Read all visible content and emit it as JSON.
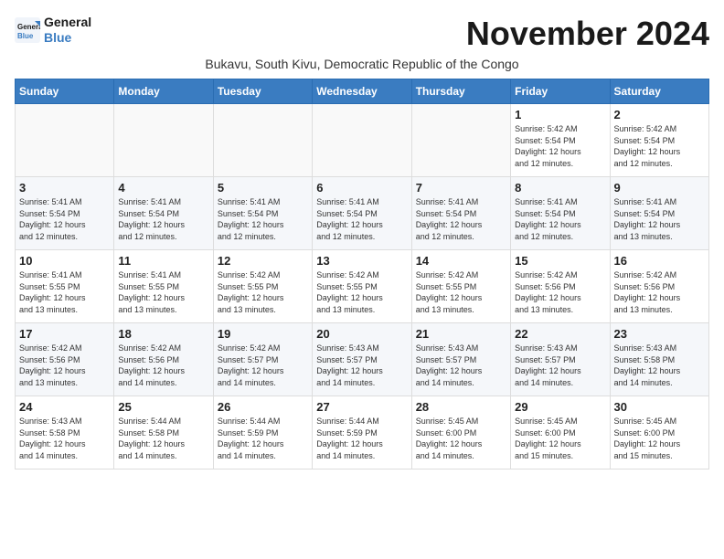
{
  "header": {
    "logo_line1": "General",
    "logo_line2": "Blue",
    "month_title": "November 2024",
    "subtitle": "Bukavu, South Kivu, Democratic Republic of the Congo"
  },
  "weekdays": [
    "Sunday",
    "Monday",
    "Tuesday",
    "Wednesday",
    "Thursday",
    "Friday",
    "Saturday"
  ],
  "weeks": [
    [
      {
        "day": "",
        "info": ""
      },
      {
        "day": "",
        "info": ""
      },
      {
        "day": "",
        "info": ""
      },
      {
        "day": "",
        "info": ""
      },
      {
        "day": "",
        "info": ""
      },
      {
        "day": "1",
        "info": "Sunrise: 5:42 AM\nSunset: 5:54 PM\nDaylight: 12 hours\nand 12 minutes."
      },
      {
        "day": "2",
        "info": "Sunrise: 5:42 AM\nSunset: 5:54 PM\nDaylight: 12 hours\nand 12 minutes."
      }
    ],
    [
      {
        "day": "3",
        "info": "Sunrise: 5:41 AM\nSunset: 5:54 PM\nDaylight: 12 hours\nand 12 minutes."
      },
      {
        "day": "4",
        "info": "Sunrise: 5:41 AM\nSunset: 5:54 PM\nDaylight: 12 hours\nand 12 minutes."
      },
      {
        "day": "5",
        "info": "Sunrise: 5:41 AM\nSunset: 5:54 PM\nDaylight: 12 hours\nand 12 minutes."
      },
      {
        "day": "6",
        "info": "Sunrise: 5:41 AM\nSunset: 5:54 PM\nDaylight: 12 hours\nand 12 minutes."
      },
      {
        "day": "7",
        "info": "Sunrise: 5:41 AM\nSunset: 5:54 PM\nDaylight: 12 hours\nand 12 minutes."
      },
      {
        "day": "8",
        "info": "Sunrise: 5:41 AM\nSunset: 5:54 PM\nDaylight: 12 hours\nand 12 minutes."
      },
      {
        "day": "9",
        "info": "Sunrise: 5:41 AM\nSunset: 5:54 PM\nDaylight: 12 hours\nand 13 minutes."
      }
    ],
    [
      {
        "day": "10",
        "info": "Sunrise: 5:41 AM\nSunset: 5:55 PM\nDaylight: 12 hours\nand 13 minutes."
      },
      {
        "day": "11",
        "info": "Sunrise: 5:41 AM\nSunset: 5:55 PM\nDaylight: 12 hours\nand 13 minutes."
      },
      {
        "day": "12",
        "info": "Sunrise: 5:42 AM\nSunset: 5:55 PM\nDaylight: 12 hours\nand 13 minutes."
      },
      {
        "day": "13",
        "info": "Sunrise: 5:42 AM\nSunset: 5:55 PM\nDaylight: 12 hours\nand 13 minutes."
      },
      {
        "day": "14",
        "info": "Sunrise: 5:42 AM\nSunset: 5:55 PM\nDaylight: 12 hours\nand 13 minutes."
      },
      {
        "day": "15",
        "info": "Sunrise: 5:42 AM\nSunset: 5:56 PM\nDaylight: 12 hours\nand 13 minutes."
      },
      {
        "day": "16",
        "info": "Sunrise: 5:42 AM\nSunset: 5:56 PM\nDaylight: 12 hours\nand 13 minutes."
      }
    ],
    [
      {
        "day": "17",
        "info": "Sunrise: 5:42 AM\nSunset: 5:56 PM\nDaylight: 12 hours\nand 13 minutes."
      },
      {
        "day": "18",
        "info": "Sunrise: 5:42 AM\nSunset: 5:56 PM\nDaylight: 12 hours\nand 14 minutes."
      },
      {
        "day": "19",
        "info": "Sunrise: 5:42 AM\nSunset: 5:57 PM\nDaylight: 12 hours\nand 14 minutes."
      },
      {
        "day": "20",
        "info": "Sunrise: 5:43 AM\nSunset: 5:57 PM\nDaylight: 12 hours\nand 14 minutes."
      },
      {
        "day": "21",
        "info": "Sunrise: 5:43 AM\nSunset: 5:57 PM\nDaylight: 12 hours\nand 14 minutes."
      },
      {
        "day": "22",
        "info": "Sunrise: 5:43 AM\nSunset: 5:57 PM\nDaylight: 12 hours\nand 14 minutes."
      },
      {
        "day": "23",
        "info": "Sunrise: 5:43 AM\nSunset: 5:58 PM\nDaylight: 12 hours\nand 14 minutes."
      }
    ],
    [
      {
        "day": "24",
        "info": "Sunrise: 5:43 AM\nSunset: 5:58 PM\nDaylight: 12 hours\nand 14 minutes."
      },
      {
        "day": "25",
        "info": "Sunrise: 5:44 AM\nSunset: 5:58 PM\nDaylight: 12 hours\nand 14 minutes."
      },
      {
        "day": "26",
        "info": "Sunrise: 5:44 AM\nSunset: 5:59 PM\nDaylight: 12 hours\nand 14 minutes."
      },
      {
        "day": "27",
        "info": "Sunrise: 5:44 AM\nSunset: 5:59 PM\nDaylight: 12 hours\nand 14 minutes."
      },
      {
        "day": "28",
        "info": "Sunrise: 5:45 AM\nSunset: 6:00 PM\nDaylight: 12 hours\nand 14 minutes."
      },
      {
        "day": "29",
        "info": "Sunrise: 5:45 AM\nSunset: 6:00 PM\nDaylight: 12 hours\nand 15 minutes."
      },
      {
        "day": "30",
        "info": "Sunrise: 5:45 AM\nSunset: 6:00 PM\nDaylight: 12 hours\nand 15 minutes."
      }
    ]
  ]
}
